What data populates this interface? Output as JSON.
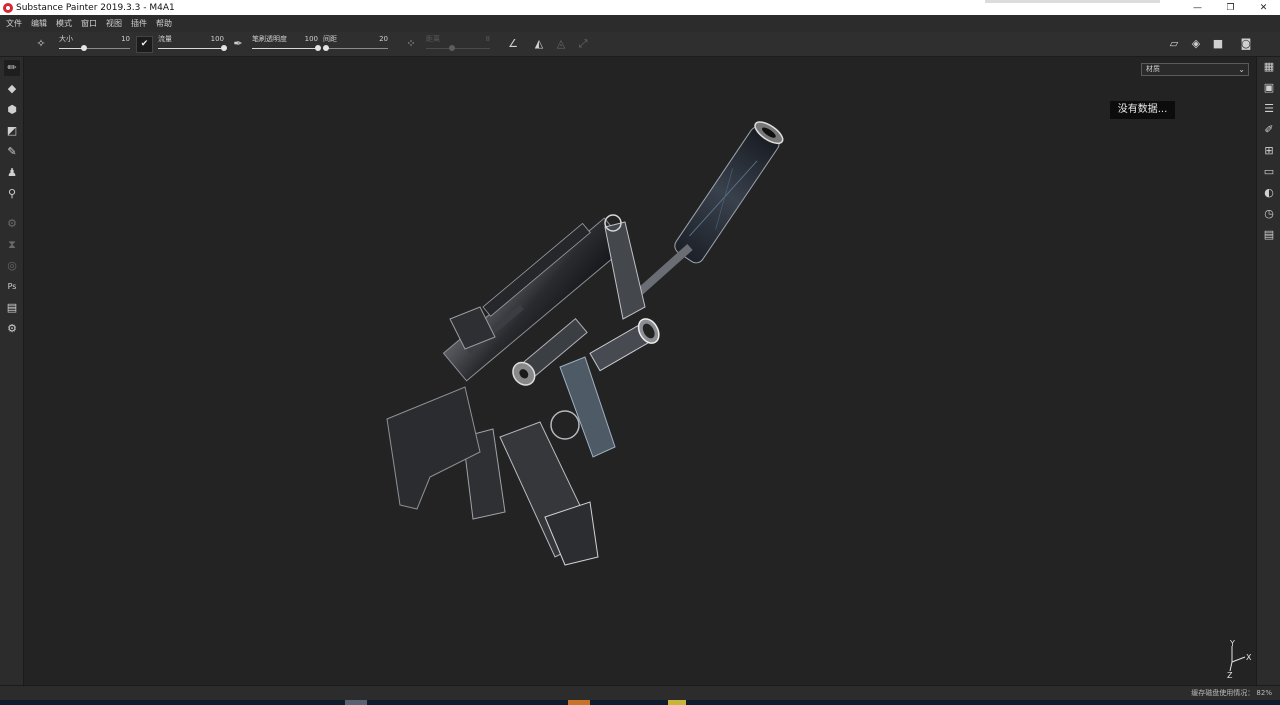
{
  "window": {
    "title": "Substance Painter 2019.3.3 - M4A1",
    "buttons": {
      "minimize": "—",
      "restore": "❐",
      "close": "✕"
    }
  },
  "menu": [
    "文件",
    "编辑",
    "模式",
    "窗口",
    "视图",
    "插件",
    "帮助"
  ],
  "toolbar": {
    "size": {
      "label": "大小",
      "value": "10",
      "fraction": 0.35
    },
    "flow": {
      "label": "流量",
      "value": "100",
      "fraction": 1.0
    },
    "opacity": {
      "label": "笔刷透明度",
      "value": "100",
      "fraction": 1.0
    },
    "spacing": {
      "label": "间距",
      "value": "20",
      "fraction": 0.04
    },
    "distance": {
      "label": "距离",
      "value": "8",
      "fraction": 0.4
    }
  },
  "viewport": {
    "channel_select": "材质",
    "tooltip": "没有数据...",
    "axis": {
      "y": "Y",
      "x": "X",
      "z": "Z"
    }
  },
  "status": {
    "disk_usage": "缓存磁盘使用情况：  82%"
  },
  "colors": {
    "background": "#232323",
    "panel": "#2c2c2c",
    "accent": "#d6262e"
  }
}
